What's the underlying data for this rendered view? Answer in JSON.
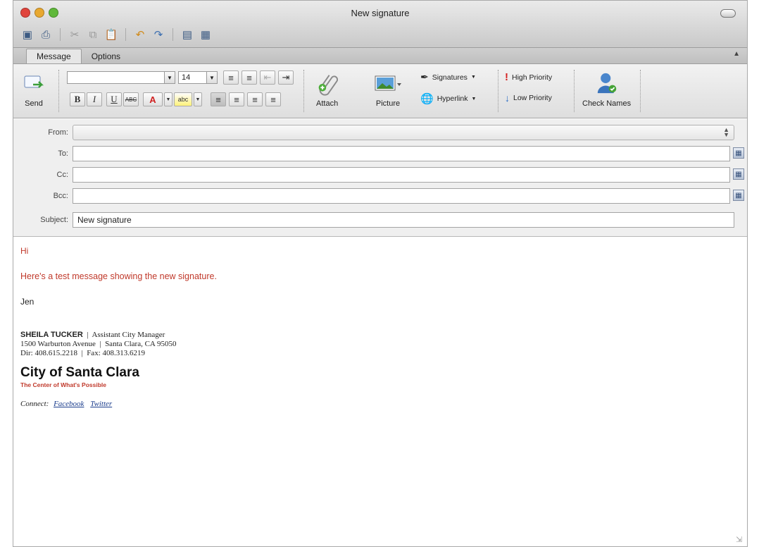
{
  "window": {
    "title": "New signature"
  },
  "quick_toolbar": [
    "save-icon",
    "print-icon",
    "cut-icon",
    "copy-icon",
    "paste-icon",
    "undo-icon",
    "redo-icon",
    "insert-icon",
    "layout-icon"
  ],
  "tabs": [
    {
      "label": "Message",
      "active": true
    },
    {
      "label": "Options",
      "active": false
    }
  ],
  "ribbon": {
    "send": "Send",
    "font_size": "14",
    "bold": "B",
    "italic": "I",
    "underline": "U",
    "strike": "ABC",
    "highlight_label": "abc",
    "attach": "Attach",
    "picture": "Picture",
    "signatures": "Signatures",
    "hyperlink": "Hyperlink",
    "high_priority": "High Priority",
    "low_priority": "Low Priority",
    "check_names": "Check Names"
  },
  "fields": {
    "from_label": "From:",
    "to_label": "To:",
    "cc_label": "Cc:",
    "bcc_label": "Bcc:",
    "subject_label": "Subject:",
    "subject_value": "New signature"
  },
  "message": {
    "greeting": "Hi",
    "line1": "Here's a test message showing the new signature.",
    "sender": "Jen"
  },
  "signature": {
    "name": "SHEILA TUCKER",
    "role": "Assistant City Manager",
    "address_street": "1500 Warburton Avenue",
    "address_city": "Santa Clara, CA 95050",
    "dir": "Dir: 408.615.2218",
    "fax": "Fax: 408.313.6219",
    "org": "City of Santa Clara",
    "tagline": "The Center of What's Possible",
    "connect_label": "Connect:",
    "facebook": "Facebook",
    "twitter": "Twitter"
  },
  "colors": {
    "accent_red": "#c0392b",
    "link_blue": "#1a3c8c"
  }
}
